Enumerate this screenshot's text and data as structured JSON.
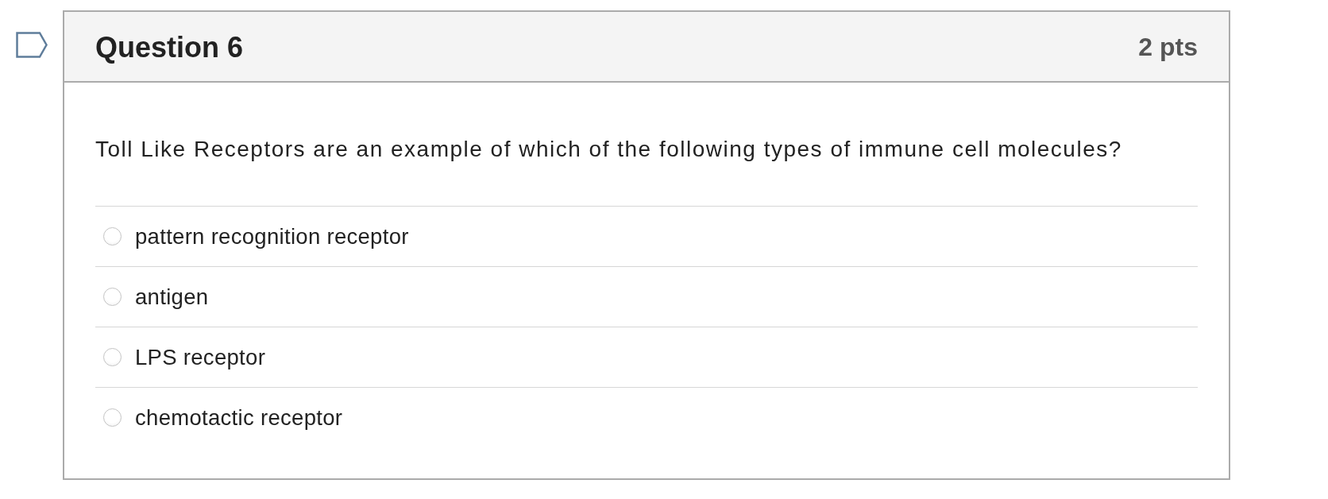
{
  "question": {
    "flagged": false,
    "title": "Question 6",
    "points": "2 pts",
    "text": "Toll Like Receptors are an example of which of the following types of immune cell molecules?",
    "answers": [
      {
        "label": "pattern recognition receptor",
        "selected": false
      },
      {
        "label": "antigen",
        "selected": false
      },
      {
        "label": "LPS receptor",
        "selected": false
      },
      {
        "label": "chemotactic receptor",
        "selected": false
      }
    ]
  }
}
